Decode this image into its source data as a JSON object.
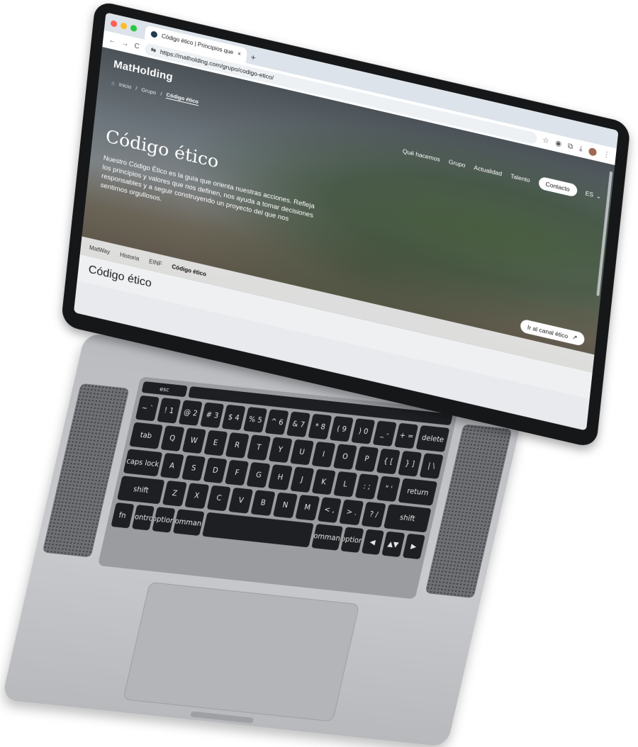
{
  "browser": {
    "tab_title": "Código ético | Principios que",
    "tab_close": "×",
    "new_tab": "+",
    "url": "https://matholding.com/grupo/codigo-etico/",
    "nav_back": "←",
    "nav_forward": "→",
    "nav_reload": "C",
    "site_info": "⇆",
    "star": "☆",
    "camera": "◉",
    "extensions": "⧉",
    "download": "⤓",
    "menu": "⋮"
  },
  "site": {
    "logo": "MatHolding",
    "breadcrumb": [
      "Inicio",
      "/",
      "Grupo",
      "/",
      "Código ético"
    ],
    "nav": [
      "Qué hacemos",
      "Grupo",
      "Actualidad",
      "Talento"
    ],
    "contact": "Contacto",
    "lang": "ES",
    "lang_chevron": "⌄",
    "hero_title": "Código ético",
    "hero_text": "Nuestro Código Ético es la guía que orienta nuestras acciones. Refleja los principios y valores que nos definen, nos ayuda a tomar decisiones responsables y a seguir construyendo un proyecto del que nos sentimos orgullosos.",
    "subnav": [
      "MatWay",
      "Historia",
      "EINF",
      "Código ético"
    ],
    "ethics_channel": "Ir al canal ético",
    "ethics_arrow": "↗",
    "section_title": "Código ético"
  },
  "keyboard": {
    "fn_row": [
      "esc",
      "",
      "",
      "",
      "",
      "",
      "",
      "",
      "",
      "",
      "",
      "",
      ""
    ],
    "row1": [
      "~ `",
      "! 1",
      "@ 2",
      "# 3",
      "$ 4",
      "% 5",
      "^ 6",
      "& 7",
      "* 8",
      "( 9",
      ") 0",
      "_ -",
      "+ =",
      "delete"
    ],
    "row2": [
      "tab",
      "Q",
      "W",
      "E",
      "R",
      "T",
      "Y",
      "U",
      "I",
      "O",
      "P",
      "{ [",
      "} ]",
      "| \\"
    ],
    "row3": [
      "caps lock",
      "A",
      "S",
      "D",
      "F",
      "G",
      "H",
      "J",
      "K",
      "L",
      ": ;",
      "\" '",
      "return"
    ],
    "row4": [
      "shift",
      "Z",
      "X",
      "C",
      "V",
      "B",
      "N",
      "M",
      "< ,",
      "> .",
      "? /",
      "shift"
    ],
    "row5": [
      "fn",
      "control",
      "option",
      "command",
      "",
      "command",
      "option",
      "◀",
      "▲▼",
      "▶"
    ]
  },
  "colors": {
    "traffic_red": "#ff5f57",
    "traffic_yellow": "#febc2e",
    "traffic_green": "#28c840"
  }
}
